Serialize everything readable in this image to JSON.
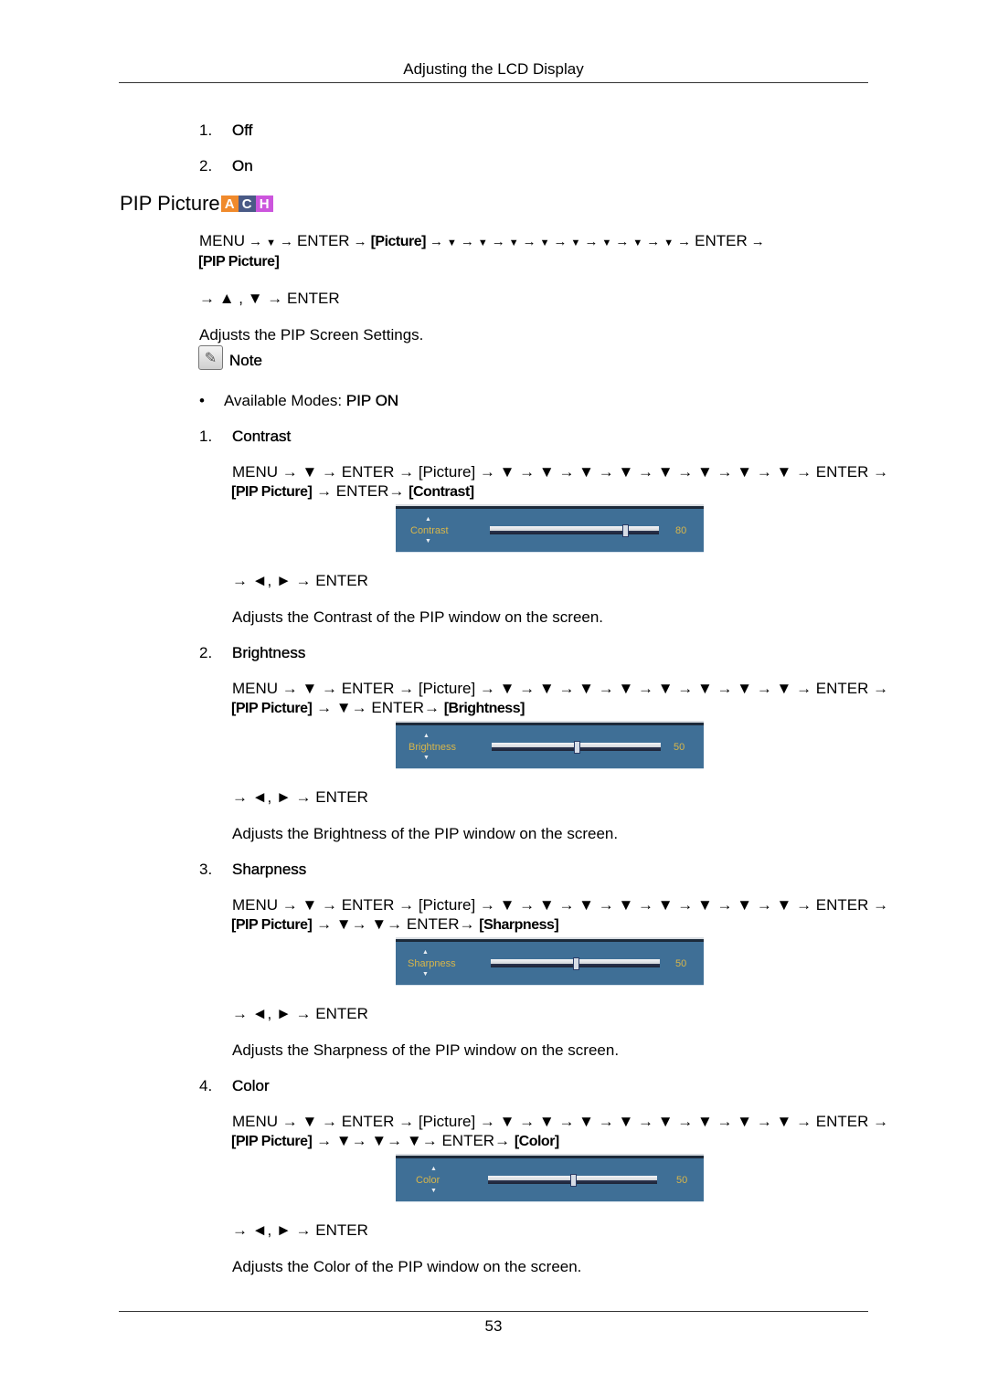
{
  "header": {
    "title": "Adjusting the LCD Display"
  },
  "top_list": [
    {
      "num": "1.",
      "label": "Off"
    },
    {
      "num": "2.",
      "label": "On"
    }
  ],
  "section": {
    "title": "PIP Picture",
    "mode_badges": [
      {
        "letter": "A",
        "color": "#f08a2c"
      },
      {
        "letter": "C",
        "color": "#4a5a86"
      },
      {
        "letter": "H",
        "color": "#cc55dd"
      }
    ],
    "path_line1": [
      "MENU",
      "→",
      "▼",
      "→",
      "ENTER",
      "→",
      "[Picture]",
      "→",
      "▼",
      "→",
      "▼",
      "→",
      "▼",
      "→",
      "▼",
      "→",
      "▼",
      "→",
      "▼",
      "→",
      "▼",
      "→",
      "▼",
      "→",
      "ENTER",
      "→"
    ],
    "path_line2": "[PIP Picture]",
    "nav_line": "→ ▲ , ▼ → ENTER",
    "description": "Adjusts the PIP Screen Settings.",
    "note_label": "Note",
    "bullet": {
      "prefix": "Available Modes: ",
      "value": "PIP ON"
    }
  },
  "items": [
    {
      "num": "1.",
      "label": "Contrast",
      "path_line1": "MENU → ▼ → ENTER → [Picture] → ▼ → ▼ → ▼ → ▼ → ▼ → ▼ → ▼ → ▼ → ENTER →",
      "path_line2": {
        "menu": "[PIP Picture]",
        "steps": "→ ENTER→",
        "target": "[Contrast]"
      },
      "osd": {
        "label": "Contrast",
        "value": "80",
        "level": 80
      },
      "nav_line": "→ ◄, ► → ENTER",
      "description": "Adjusts the Contrast of the PIP window on the screen."
    },
    {
      "num": "2.",
      "label": "Brightness",
      "path_line1": "MENU → ▼ → ENTER → [Picture] → ▼ → ▼ → ▼ → ▼ → ▼ → ▼ → ▼ → ▼ → ENTER →",
      "path_line2": {
        "menu": "[PIP Picture]",
        "steps": "→ ▼→ ENTER→",
        "target": "[Brightness]"
      },
      "osd": {
        "label": "Brightness",
        "value": "50",
        "level": 50
      },
      "nav_line": "→ ◄, ► → ENTER",
      "description": "Adjusts the Brightness of the PIP window on the screen."
    },
    {
      "num": "3.",
      "label": "Sharpness",
      "path_line1": "MENU → ▼ → ENTER → [Picture] → ▼ → ▼ → ▼ → ▼ → ▼ → ▼ → ▼ → ▼ → ENTER →",
      "path_line2": {
        "menu": "[PIP Picture]",
        "steps": "→ ▼→ ▼→ ENTER→",
        "target": "[Sharpness]"
      },
      "osd": {
        "label": "Sharpness",
        "value": "50",
        "level": 50
      },
      "nav_line": "→ ◄, ► → ENTER",
      "description": "Adjusts the Sharpness of the PIP window on the screen."
    },
    {
      "num": "4.",
      "label": "Color",
      "path_line1": "MENU → ▼ → ENTER → [Picture] → ▼ → ▼ → ▼ → ▼ → ▼ → ▼ → ▼ → ▼ → ENTER →",
      "path_line2": {
        "menu": "[PIP Picture]",
        "steps": "→ ▼→ ▼→ ▼→ ENTER→",
        "target": "[Color]"
      },
      "osd": {
        "label": "Color",
        "value": "50",
        "level": 50
      },
      "nav_line": "→ ◄, ► → ENTER",
      "description": "Adjusts the Color of the PIP window on the screen."
    }
  ],
  "footer": {
    "page_number": "53"
  }
}
